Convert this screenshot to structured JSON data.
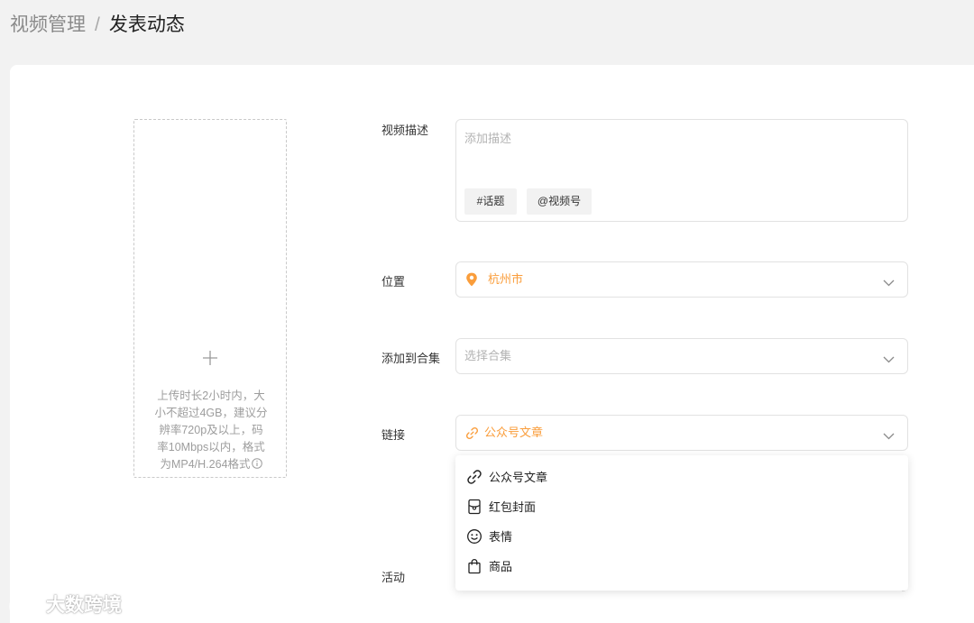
{
  "breadcrumb": {
    "parent": "视频管理",
    "separator": "/",
    "current": "发表动态"
  },
  "upload": {
    "tip_lines": [
      "上传时长2小时内，大",
      "小不超过4GB，建议分",
      "辨率720p及以上，码",
      "率10Mbps以内，格式",
      "为MP4/H.264格式"
    ],
    "icon": "plus-icon"
  },
  "form": {
    "description": {
      "label": "视频描述",
      "placeholder": "添加描述",
      "topic_tag": "#话题",
      "account_tag": "@视频号"
    },
    "location": {
      "label": "位置",
      "value": "杭州市",
      "icon": "location-pin-icon"
    },
    "collection": {
      "label": "添加到合集",
      "placeholder": "选择合集"
    },
    "link": {
      "label": "链接",
      "value": "公众号文章",
      "icon": "link-icon"
    },
    "activity": {
      "label": "活动"
    }
  },
  "link_dropdown": {
    "options": [
      {
        "label": "公众号文章",
        "icon": "link-icon"
      },
      {
        "label": "红包封面",
        "icon": "red-packet-cover-icon"
      },
      {
        "label": "表情",
        "icon": "smiley-icon"
      },
      {
        "label": "商品",
        "icon": "shopping-bag-icon"
      }
    ]
  },
  "watermark": {
    "text": "大数跨境"
  },
  "colors": {
    "accent": "#fa9d3b",
    "page_bg": "#f2f2f2",
    "card_bg": "#ffffff",
    "border": "#e2e2e2",
    "placeholder": "#b3b3b3"
  }
}
